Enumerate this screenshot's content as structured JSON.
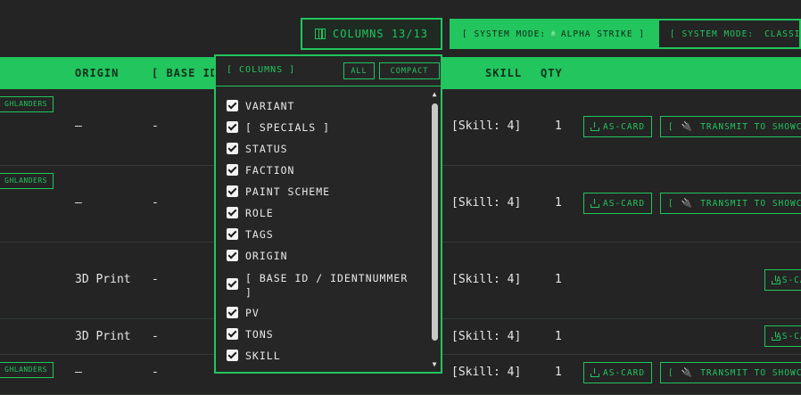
{
  "toolbar": {
    "columns_button": "COLUMNS 13/13",
    "modes": [
      {
        "label": "[ SYSTEM MODE:",
        "value": "ALPHA STRIKE ]",
        "color": "#22c55e"
      },
      {
        "label": "[ SYSTEM MODE:",
        "value": "CLASSIC ]",
        "color": "#ef4444"
      }
    ]
  },
  "table": {
    "headers": {
      "origin": "ORIGIN",
      "base_id": "[ BASE ID",
      "skill": "SKILL",
      "qty": "QTY"
    },
    "rows": [
      {
        "tag": "GHLANDERS",
        "origin": "—",
        "base_id": "-",
        "skill": "[Skill: 4]",
        "qty": "1",
        "as_card": "AS-CARD",
        "transmit": "TRANSMIT TO SHOWCASE"
      },
      {
        "tag": "GHLANDERS",
        "origin": "—",
        "base_id": "-",
        "skill": "[Skill: 4]",
        "qty": "1",
        "as_card": "AS-CARD",
        "transmit": "TRANSMIT TO SHOWCASE"
      },
      {
        "tag": "",
        "origin": "3D Print",
        "base_id": "-",
        "skill": "[Skill: 4]",
        "qty": "1",
        "as_card": "AS-CARD",
        "transmit": ""
      },
      {
        "tag": "",
        "origin": "3D Print",
        "base_id": "-",
        "skill": "[Skill: 4]",
        "qty": "1",
        "as_card": "AS-CARD",
        "transmit": ""
      },
      {
        "tag": "GHLANDERS",
        "origin": "—",
        "base_id": "-",
        "skill": "[Skill: 4]",
        "qty": "1",
        "as_card": "AS-CARD",
        "transmit": "TRANSMIT TO SHOWCASE"
      }
    ]
  },
  "columns_dropdown": {
    "title": "[ COLUMNS ]",
    "all_button": "ALL",
    "compact_button": "COMPACT",
    "items": [
      {
        "label": "VARIANT",
        "checked": true
      },
      {
        "label": "[ SPECIALS ]",
        "checked": true
      },
      {
        "label": "STATUS",
        "checked": true
      },
      {
        "label": "FACTION",
        "checked": true
      },
      {
        "label": "PAINT SCHEME",
        "checked": true
      },
      {
        "label": "ROLE",
        "checked": true
      },
      {
        "label": "TAGS",
        "checked": true
      },
      {
        "label": "ORIGIN",
        "checked": true
      },
      {
        "label": "[ BASE ID / IDENTNUMMER ]",
        "checked": true
      },
      {
        "label": "PV",
        "checked": true
      },
      {
        "label": "TONS",
        "checked": true
      },
      {
        "label": "SKILL",
        "checked": true
      }
    ]
  }
}
